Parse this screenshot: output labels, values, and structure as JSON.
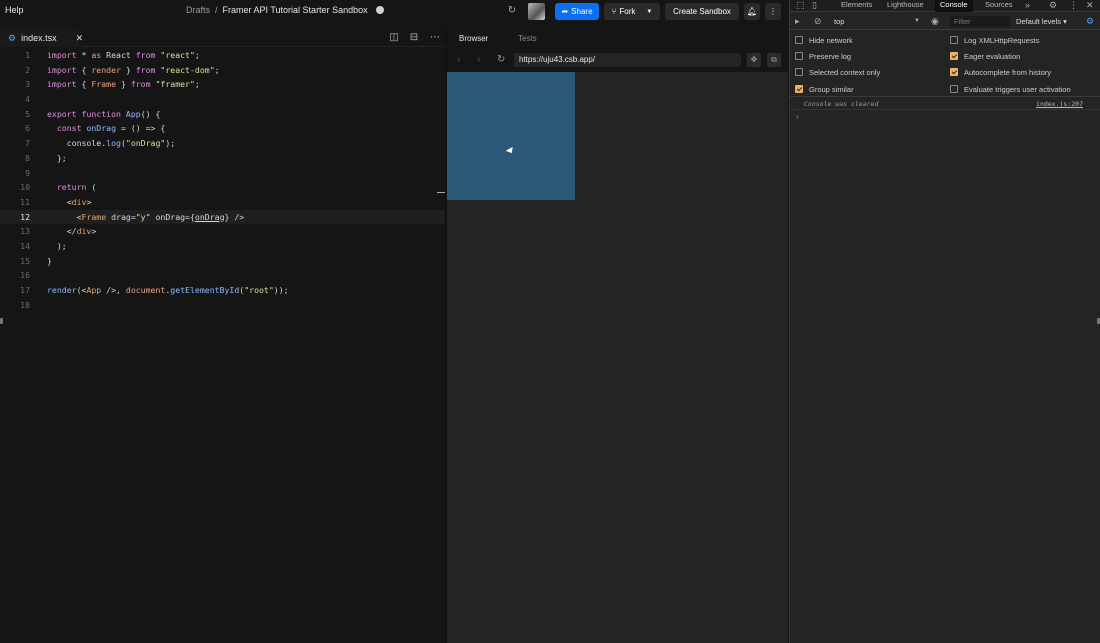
{
  "topbar": {
    "help": "Help",
    "breadcrumb_drafts": "Drafts",
    "breadcrumb_sep": "/",
    "sandbox_title": "Framer API Tutorial Starter Sandbox",
    "share_label": "Share",
    "fork_label": "Fork",
    "create_label": "Create Sandbox"
  },
  "editor": {
    "file_tab": "index.tsx",
    "active_line": 12,
    "lines": [
      {
        "n": "1"
      },
      {
        "n": "2"
      },
      {
        "n": "3"
      },
      {
        "n": "4"
      },
      {
        "n": "5"
      },
      {
        "n": "6"
      },
      {
        "n": "7"
      },
      {
        "n": "8"
      },
      {
        "n": "9"
      },
      {
        "n": "10"
      },
      {
        "n": "11"
      },
      {
        "n": "12"
      },
      {
        "n": "13"
      },
      {
        "n": "14"
      },
      {
        "n": "15"
      },
      {
        "n": "16"
      },
      {
        "n": "17"
      },
      {
        "n": "18"
      }
    ],
    "code": {
      "l1": [
        "import",
        " * ",
        "as",
        " React ",
        "from",
        " ",
        "\"react\"",
        ";"
      ],
      "l2": [
        "import",
        " { ",
        "render",
        " } ",
        "from",
        " ",
        "\"react-dom\"",
        ";"
      ],
      "l3": [
        "import",
        " { ",
        "Frame",
        " } ",
        "from",
        " ",
        "\"framer\"",
        ";"
      ],
      "l5": [
        "export",
        " ",
        "function",
        " ",
        "App",
        "() {"
      ],
      "l6": [
        "  ",
        "const",
        " ",
        "onDrag",
        " = () => {"
      ],
      "l7": [
        "    console.",
        "log",
        "(",
        "\"onDrag\"",
        ");"
      ],
      "l8": [
        "  };"
      ],
      "l10": [
        "  ",
        "return",
        " ("
      ],
      "l11": [
        "    <",
        "div",
        ">"
      ],
      "l12": [
        "      <",
        "Frame",
        " drag=",
        "\"y\"",
        " onDrag={",
        "onDrag",
        "} />"
      ],
      "l13": [
        "    </",
        "div",
        ">"
      ],
      "l14": [
        "  );"
      ],
      "l15": [
        "}"
      ],
      "l17": [
        "render",
        "(<",
        "App",
        " />, ",
        "document",
        ".",
        "getElementById",
        "(",
        "\"root\"",
        "));"
      ]
    }
  },
  "preview": {
    "tab_browser": "Browser",
    "tab_tests": "Tests",
    "url": "https://uju43.csb.app/",
    "frame_color": "#2b5977"
  },
  "devtools": {
    "tab_elements": "Elements",
    "tab_lighthouse": "Lighthouse",
    "tab_console": "Console",
    "tab_sources": "Sources",
    "more_tabs": "»",
    "context": "top",
    "filter_placeholder": "Filter",
    "levels": "Default levels ▾",
    "options_left": [
      {
        "label": "Hide network",
        "checked": false
      },
      {
        "label": "Preserve log",
        "checked": false
      },
      {
        "label": "Selected context only",
        "checked": false
      },
      {
        "label": "Group similar",
        "checked": true
      }
    ],
    "options_right": [
      {
        "label": "Log XMLHttpRequests",
        "checked": false
      },
      {
        "label": "Eager evaluation",
        "checked": true
      },
      {
        "label": "Autocomplete from history",
        "checked": true
      },
      {
        "label": "Evaluate triggers user activation",
        "checked": false
      }
    ],
    "console_message": "Console was cleared",
    "console_source": "index.js:207",
    "prompt": "›"
  }
}
